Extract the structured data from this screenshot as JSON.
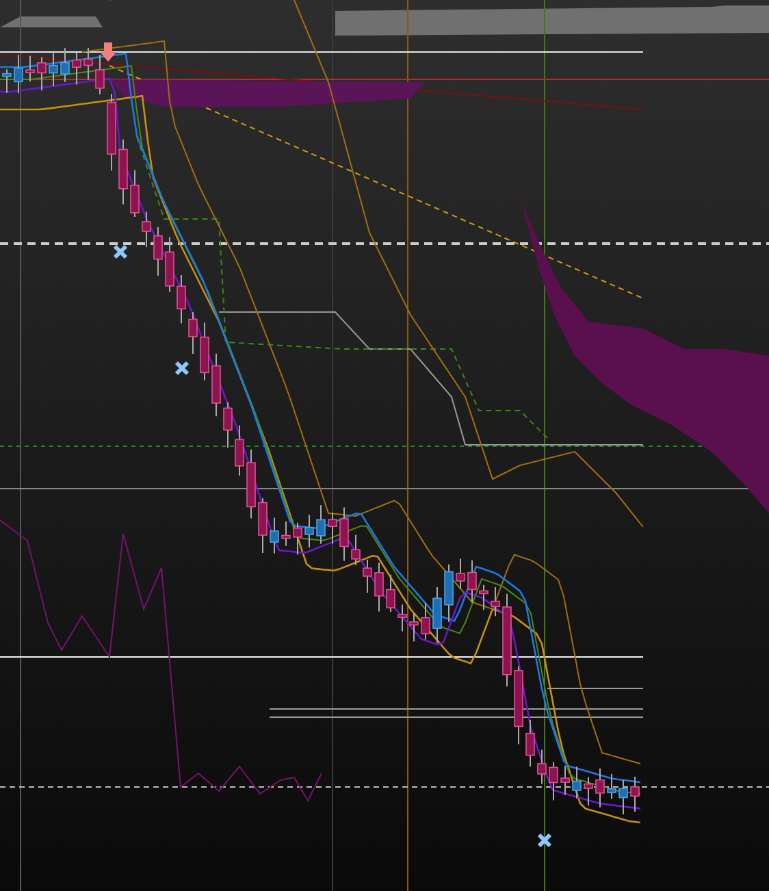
{
  "chart": {
    "kind": "candlestick"
  }
}
